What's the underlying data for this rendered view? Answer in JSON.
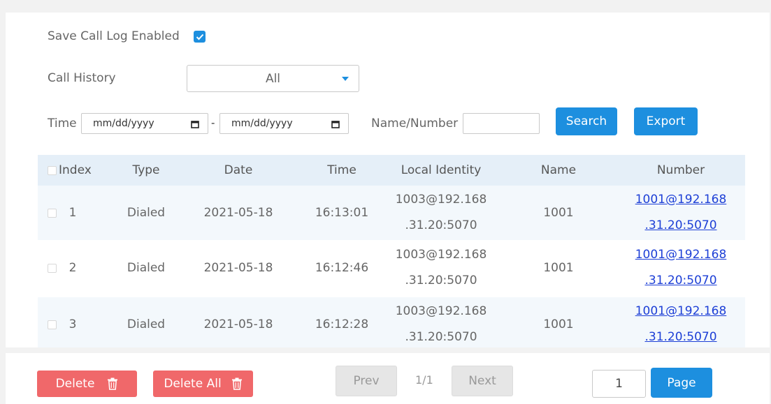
{
  "settings": {
    "save_call_log_label": "Save Call Log Enabled",
    "save_call_log_checked": true,
    "call_history_label": "Call History",
    "call_history_value": "All"
  },
  "filter": {
    "time_label": "Time",
    "date_from": "mm/dd/yyyy",
    "separator": "-",
    "date_to": "mm/dd/yyyy",
    "name_number_label": "Name/Number",
    "name_number_value": "",
    "search_label": "Search",
    "export_label": "Export"
  },
  "table": {
    "headers": [
      "Index",
      "Type",
      "Date",
      "Time",
      "Local Identity",
      "Name",
      "Number"
    ],
    "rows": [
      {
        "index": "1",
        "type": "Dialed",
        "date": "2021-05-18",
        "time": "16:13:01",
        "local_1": "1003@192.168",
        "local_2": ".31.20:5070",
        "name": "1001",
        "number_1": "1001@192.168",
        "number_2": ".31.20:5070"
      },
      {
        "index": "2",
        "type": "Dialed",
        "date": "2021-05-18",
        "time": "16:12:46",
        "local_1": "1003@192.168",
        "local_2": ".31.20:5070",
        "name": "1001",
        "number_1": "1001@192.168",
        "number_2": ".31.20:5070"
      },
      {
        "index": "3",
        "type": "Dialed",
        "date": "2021-05-18",
        "time": "16:12:28",
        "local_1": "1003@192.168",
        "local_2": ".31.20:5070",
        "name": "1001",
        "number_1": "1001@192.168",
        "number_2": ".31.20:5070"
      }
    ]
  },
  "footer": {
    "delete_label": "Delete",
    "delete_all_label": "Delete All",
    "prev_label": "Prev",
    "page_info": "1/1",
    "next_label": "Next",
    "page_input": "1",
    "page_button": "Page"
  },
  "colors": {
    "accent": "#1d8fdf",
    "danger": "#f0686a",
    "link": "#1d3fd6",
    "header_bg": "#e5eff8"
  },
  "icons": {
    "checkbox": "check-icon",
    "dropdown": "caret-down-icon",
    "calendar": "calendar-icon",
    "delete": "trash-icon"
  }
}
